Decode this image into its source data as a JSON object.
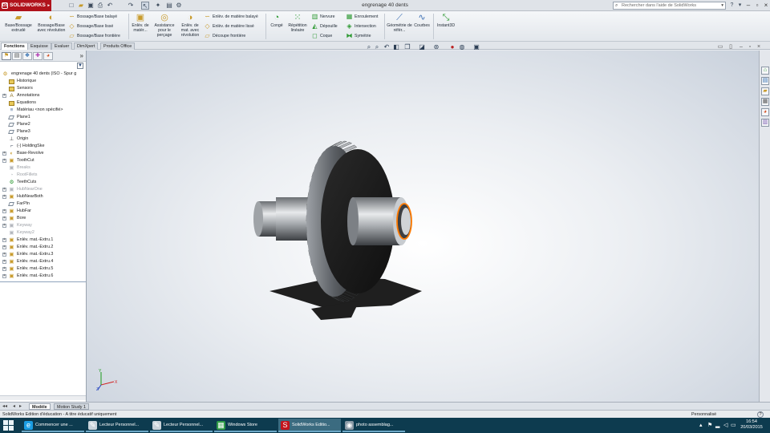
{
  "app": {
    "brand": "SOLIDWORKS",
    "window_title": "engrenage 40 dents"
  },
  "help_search": {
    "placeholder": "Rechercher dans l'aide de SolidWorks"
  },
  "ribbon": {
    "base_extrude": "Base/Bossage extrudé",
    "boss_revolve": "Bossage/Base avec révolution",
    "swept_boss": "Bossage/Base balayé",
    "lofted_boss": "Bossage/Base lissé",
    "boundary_boss": "Bossage/Base frontière",
    "extruded_cut": "Enlèv. de matér...",
    "hole_wizard": "Assistance pour le perçage",
    "revolved_cut": "Enlèv. de mat. avec révolution",
    "swept_cut": "Enlèv. de matière balayé",
    "lofted_cut": "Enlèv. de matière lissé",
    "boundary_cut": "Découpe frontière",
    "fillet": "Congé",
    "linear_pattern": "Répétition linéaire",
    "rib": "Nervure",
    "draft": "Dépouille",
    "shell": "Coque",
    "wrap": "Enroulement",
    "intersect": "Intersection",
    "mirror": "Symétrie",
    "ref_geometry": "Géométrie de référ...",
    "curves": "Courbes",
    "instant3d": "Instant3D"
  },
  "tabs": [
    {
      "label": "Fonctions",
      "active": true
    },
    {
      "label": "Esquisse",
      "active": false
    },
    {
      "label": "Evaluer",
      "active": false
    },
    {
      "label": "DimXpert",
      "active": false
    },
    {
      "label": "Produits Office",
      "active": false
    }
  ],
  "tree": {
    "root": "engrenage 40 dents  (ISO - Spur g",
    "items": [
      {
        "label": "Historique",
        "icon": "folder-icon",
        "expandable": false,
        "suppressed": false
      },
      {
        "label": "Sensors",
        "icon": "folder-icon",
        "expandable": false,
        "suppressed": false
      },
      {
        "label": "Annotations",
        "icon": "annotation-icon",
        "expandable": true,
        "suppressed": false
      },
      {
        "label": "Equations",
        "icon": "folder-icon",
        "expandable": false,
        "suppressed": false
      },
      {
        "label": "Matériau <non spécifié>",
        "icon": "material-icon",
        "expandable": false,
        "suppressed": false
      },
      {
        "label": "Plane1",
        "icon": "plane-icon",
        "expandable": false,
        "suppressed": false
      },
      {
        "label": "Plane2",
        "icon": "plane-icon",
        "expandable": false,
        "suppressed": false
      },
      {
        "label": "Plane3",
        "icon": "plane-icon",
        "expandable": false,
        "suppressed": false
      },
      {
        "label": "Origin",
        "icon": "origin-icon",
        "expandable": false,
        "suppressed": false
      },
      {
        "label": "(-) HoldingSke",
        "icon": "sketch-icon",
        "expandable": false,
        "suppressed": false
      },
      {
        "label": "Base-Revolve",
        "icon": "revolve-icon",
        "expandable": true,
        "suppressed": false
      },
      {
        "label": "ToothCut",
        "icon": "cut-icon",
        "expandable": true,
        "suppressed": false
      },
      {
        "label": "Breaks",
        "icon": "cut-icon",
        "expandable": false,
        "suppressed": true
      },
      {
        "label": "RootFillets",
        "icon": "fillet-icon",
        "expandable": false,
        "suppressed": true
      },
      {
        "label": "TeethCuts",
        "icon": "pattern-icon",
        "expandable": false,
        "suppressed": false
      },
      {
        "label": "HubNearOne",
        "icon": "boss-icon",
        "expandable": true,
        "suppressed": true
      },
      {
        "label": "HubNearBoth",
        "icon": "boss-icon",
        "expandable": true,
        "suppressed": false
      },
      {
        "label": "FarPln",
        "icon": "plane-icon",
        "expandable": false,
        "suppressed": false
      },
      {
        "label": "HubFar",
        "icon": "boss-icon",
        "expandable": true,
        "suppressed": false
      },
      {
        "label": "Bore",
        "icon": "cut-icon",
        "expandable": true,
        "suppressed": false
      },
      {
        "label": "Keyway",
        "icon": "cut-icon",
        "expandable": true,
        "suppressed": true
      },
      {
        "label": "Keyway2",
        "icon": "cut-icon",
        "expandable": false,
        "suppressed": true
      },
      {
        "label": "Enlév. mat.-Extru.1",
        "icon": "cut-icon",
        "expandable": true,
        "suppressed": false
      },
      {
        "label": "Enlév. mat.-Extru.2",
        "icon": "cut-icon",
        "expandable": true,
        "suppressed": false
      },
      {
        "label": "Enlév. mat.-Extru.3",
        "icon": "cut-icon",
        "expandable": true,
        "suppressed": false
      },
      {
        "label": "Enlév. mat.-Extru.4",
        "icon": "cut-icon",
        "expandable": true,
        "suppressed": false
      },
      {
        "label": "Enlév. mat.-Extru.5",
        "icon": "cut-icon",
        "expandable": true,
        "suppressed": false
      },
      {
        "label": "Enlév. mat.-Extru.6",
        "icon": "cut-icon",
        "expandable": true,
        "suppressed": false
      }
    ]
  },
  "bottom_tabs": [
    {
      "label": "Modèle",
      "active": true
    },
    {
      "label": "Motion Study 1",
      "active": false
    }
  ],
  "status": {
    "left": "SolidWorks Edition d'éducation - A titre éducatif uniquement",
    "units": "Personnalisé"
  },
  "taskbar": {
    "items": [
      {
        "label": "Commencer une ...",
        "icon": "ie-icon",
        "color": "#1b9de2",
        "active": false
      },
      {
        "label": "Lecteur Personnel...",
        "icon": "viewer-icon",
        "color": "#c9d3da",
        "active": false
      },
      {
        "label": "Lecteur Personnel...",
        "icon": "viewer-icon",
        "color": "#c9d3da",
        "active": false
      },
      {
        "label": "Windows Store",
        "icon": "store-icon",
        "color": "#2f9b47",
        "active": false
      },
      {
        "label": "SolidWorks Editio...",
        "icon": "solidworks-icon",
        "color": "#c4141c",
        "active": true
      },
      {
        "label": "photo assemblag...",
        "icon": "photo-icon",
        "color": "#8a9aa6",
        "active": false
      }
    ],
    "time": "16:54",
    "date": "20/03/2015"
  },
  "colors": {
    "accent": "#b0121b",
    "bore_edge": "#ff7a00",
    "gear_dark": "#1a1a1a",
    "tree_line": "#8fa3bd"
  }
}
